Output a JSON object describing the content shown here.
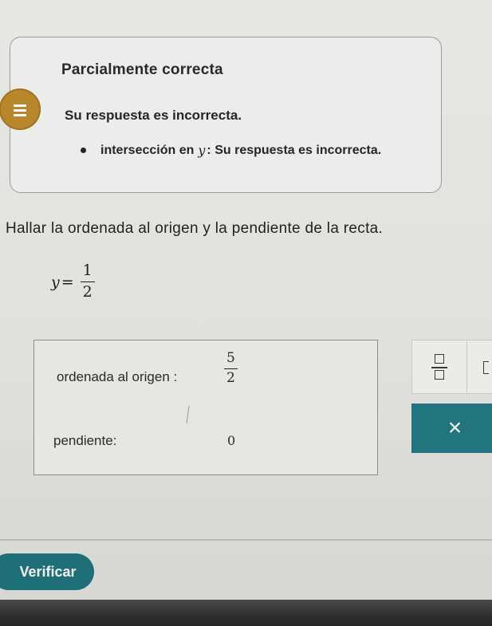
{
  "feedback": {
    "status_title": "Parcialmente correcta",
    "status_message": "Su respuesta es incorrecta.",
    "bullet": {
      "prefix": "intersección en",
      "variable": "y",
      "suffix": ": Su respuesta es incorrecta."
    },
    "icon": "list-lines-icon",
    "accent_color": "#b8862b"
  },
  "problem": {
    "prompt": "Hallar la ordenada al origen y la pendiente de la recta.",
    "equation": {
      "lhs": "y",
      "eq": "=",
      "numerator": "1",
      "denominator": "2"
    }
  },
  "answers": {
    "intercept_label": "ordenada al origen :",
    "intercept_value": {
      "numerator": "5",
      "denominator": "2"
    },
    "slope_label": "pendiente:",
    "slope_value": "0"
  },
  "palette": {
    "fraction_icon": "fraction-icon",
    "bracket_icon": "bracket-icon",
    "clear_label": "×",
    "clear_color": "#22747f"
  },
  "actions": {
    "verify_label": "Verificar",
    "verify_color": "#1f6f78"
  }
}
